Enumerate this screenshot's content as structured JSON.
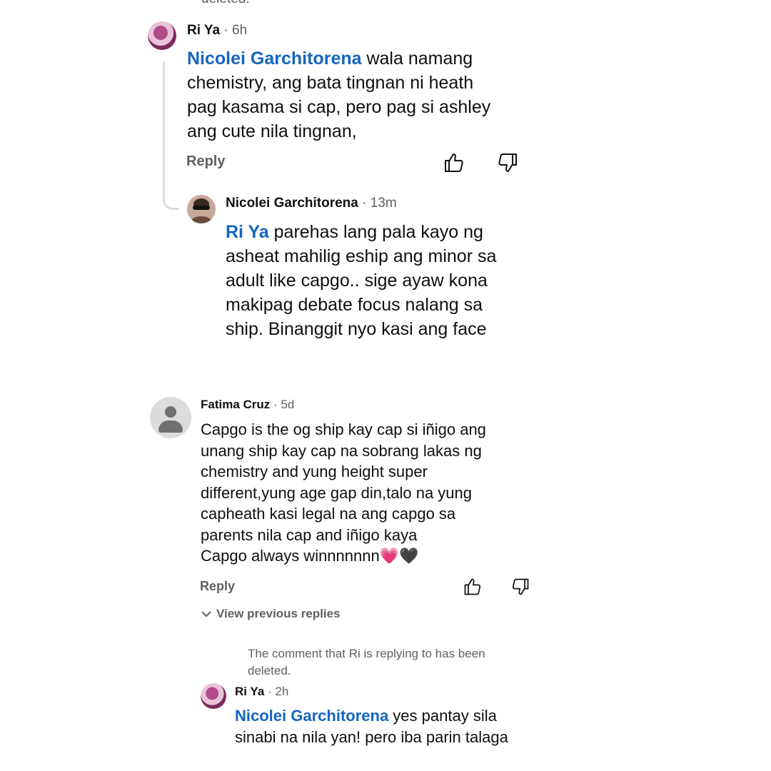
{
  "top_clip": "deleted.",
  "c1": {
    "author": "Ri Ya",
    "time": "· 6h",
    "mention": "Nicolei Garchitorena",
    "text": " wala namang\nchemistry, ang bata tingnan ni heath\npag kasama si cap, pero pag si ashley\nang cute nila tingnan,",
    "reply": "Reply"
  },
  "c2": {
    "author": "Nicolei Garchitorena",
    "time": "· 13m",
    "mention": "Ri Ya",
    "text": " parehas lang pala kayo ng\nasheat mahilig eship ang minor sa\nadult like capgo.. sige ayaw kona\nmakipag debate focus nalang sa\nship.  Binanggit nyo kasi ang face"
  },
  "c3": {
    "author": "Fatima Cruz",
    "time": "· 5d",
    "text": "Capgo is the og ship kay cap si iñigo ang\nunang ship kay cap na sobrang lakas ng\nchemistry and yung height super\ndifferent,yung age gap din,talo na yung\ncapheath kasi legal na ang capgo sa\nparents nila cap and iñigo kaya\nCapgo always winnnnnnn",
    "emoji_heart": "💗",
    "emoji_black_heart": "🖤",
    "reply": "Reply",
    "view_previous": "View previous replies"
  },
  "deleted_notice": "The comment that Ri is replying to has been\ndeleted.",
  "c4": {
    "author": "Ri Ya",
    "time": "· 2h",
    "mention": "Nicolei Garchitorena",
    "text": " yes pantay sila\nsinabi na nila yan! pero iba parin talaga"
  },
  "colors": {
    "mention": "#1565c0",
    "muted": "#606060",
    "thread_line": "#dcdcdc"
  },
  "icons": [
    "like-icon",
    "dislike-icon",
    "chevron-down-icon",
    "default-avatar-icon"
  ]
}
